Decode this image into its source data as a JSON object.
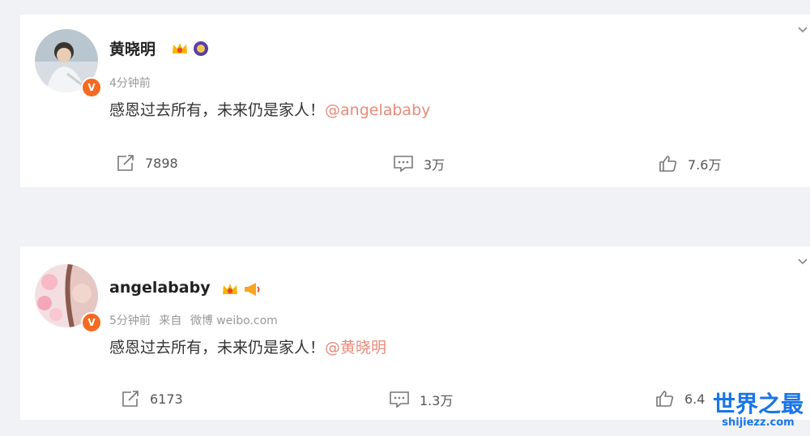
{
  "posts": [
    {
      "author": "黄晓明",
      "time": "4分钟前",
      "source_prefix": "",
      "source": "",
      "text": "感恩过去所有，未来仍是家人！",
      "mention": "@angelababy",
      "reposts": "7898",
      "comments": "3万",
      "likes": "7.6万",
      "avatar_icon": "user-avatar",
      "verified_icon": "verified-badge-icon",
      "badge_icons": [
        "vip-crown-icon",
        "purple-medal-icon"
      ]
    },
    {
      "author": "angelababy",
      "time": "5分钟前",
      "source_prefix": "来自",
      "source": "微博 weibo.com",
      "text": "感恩过去所有，未来仍是家人！",
      "mention": "@黄晓明",
      "reposts": "6173",
      "comments": "1.3万",
      "likes": "6.4",
      "avatar_icon": "user-avatar",
      "verified_icon": "verified-badge-icon",
      "badge_icons": [
        "vip-crown-icon",
        "megaphone-icon"
      ]
    }
  ],
  "watermark": {
    "title": "世界之最",
    "url": "shijiezz.com"
  },
  "colors": {
    "mention": "#e98a7a",
    "verified": "#f56b21",
    "watermark": "#1875e8"
  }
}
